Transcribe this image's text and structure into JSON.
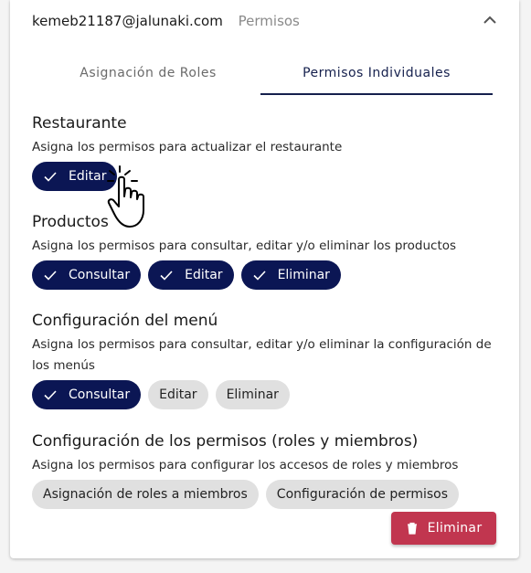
{
  "header": {
    "email": "kemeb21187@jalunaki.com",
    "label": "Permisos"
  },
  "tabs": [
    {
      "label": "Asignación de Roles"
    },
    {
      "label": "Permisos Individuales"
    }
  ],
  "sections": [
    {
      "title": "Restaurante",
      "desc": "Asigna los permisos para actualizar el restaurante",
      "chips": [
        {
          "label": "Editar",
          "selected": true
        }
      ]
    },
    {
      "title": "Productos",
      "desc": "Asigna los permisos para consultar, editar y/o eliminar los productos",
      "chips": [
        {
          "label": "Consultar",
          "selected": true
        },
        {
          "label": "Editar",
          "selected": true
        },
        {
          "label": "Eliminar",
          "selected": true
        }
      ]
    },
    {
      "title": "Configuración del menú",
      "desc": "Asigna los permisos para consultar, editar y/o eliminar la configuración de los menús",
      "chips": [
        {
          "label": "Consultar",
          "selected": true
        },
        {
          "label": "Editar",
          "selected": false
        },
        {
          "label": "Eliminar",
          "selected": false
        }
      ]
    },
    {
      "title": "Configuración de los permisos (roles y miembros)",
      "desc": "Asigna los permisos para configurar los accesos de roles y miembros",
      "chips": [
        {
          "label": "Asignación de roles a miembros",
          "selected": false
        },
        {
          "label": "Configuración de permisos",
          "selected": false
        }
      ]
    }
  ],
  "delete_button": {
    "label": "Eliminar"
  },
  "colors": {
    "primary": "#0b1654",
    "danger": "#c1364f",
    "chip_off": "#e0e0e0"
  }
}
